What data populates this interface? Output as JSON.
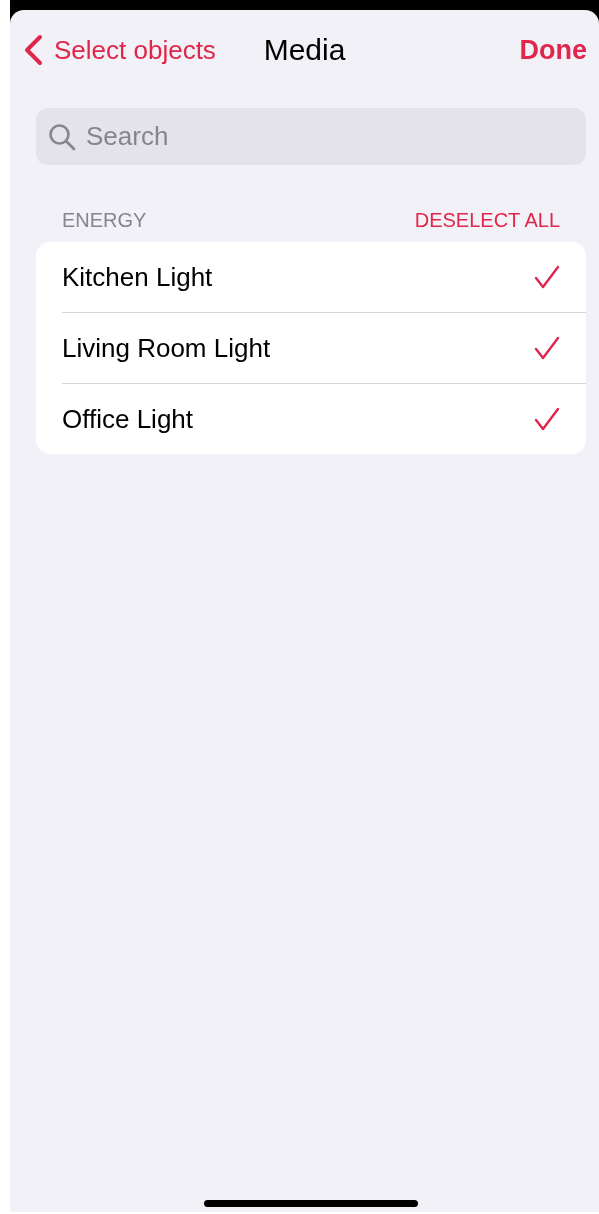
{
  "nav": {
    "back_label": "Select objects",
    "title": "Media",
    "done_label": "Done"
  },
  "search": {
    "placeholder": "Search"
  },
  "section": {
    "header": "ENERGY",
    "action": "DESELECT ALL",
    "items": [
      {
        "label": "Kitchen Light",
        "selected": true
      },
      {
        "label": "Living Room Light",
        "selected": true
      },
      {
        "label": "Office Light",
        "selected": true
      }
    ]
  }
}
